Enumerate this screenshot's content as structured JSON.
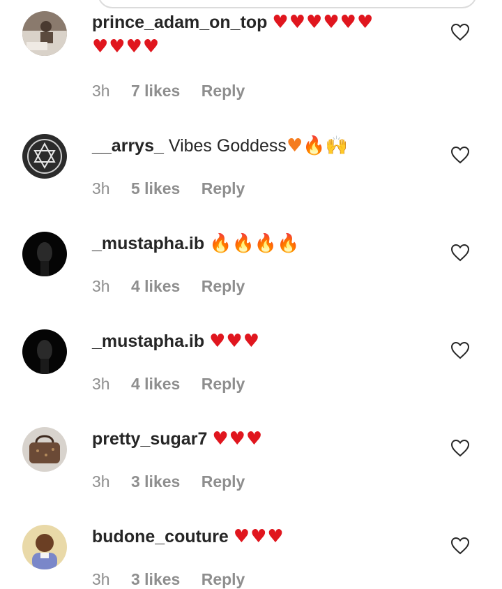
{
  "comments": [
    {
      "username": "prince_adam_on_top",
      "text": "",
      "emoji": "♥♥♥♥♥♥ ♥♥♥♥",
      "emoji_kind": "heart",
      "time": "3h",
      "likes": "7 likes",
      "reply": "Reply",
      "avatar": "avatar-photo-brown"
    },
    {
      "username": "__arrys_",
      "text": "Vibes Goddess",
      "emoji": "♥🔥🙌",
      "emoji_kind": "mixed",
      "time": "3h",
      "likes": "5 likes",
      "reply": "Reply",
      "avatar": "avatar-star-logo"
    },
    {
      "username": "_mustapha.ib",
      "text": "",
      "emoji": "🔥🔥🔥🔥",
      "emoji_kind": "fire",
      "time": "3h",
      "likes": "4 likes",
      "reply": "Reply",
      "avatar": "avatar-dark-portrait"
    },
    {
      "username": "_mustapha.ib",
      "text": "",
      "emoji": "♥♥♥",
      "emoji_kind": "heart",
      "time": "3h",
      "likes": "4 likes",
      "reply": "Reply",
      "avatar": "avatar-dark-portrait"
    },
    {
      "username": "pretty_sugar7",
      "text": "",
      "emoji": "♥♥♥",
      "emoji_kind": "heart",
      "time": "3h",
      "likes": "3 likes",
      "reply": "Reply",
      "avatar": "avatar-handbag"
    },
    {
      "username": "budone_couture",
      "text": "",
      "emoji": "♥♥♥",
      "emoji_kind": "heart",
      "time": "3h",
      "likes": "3 likes",
      "reply": "Reply",
      "avatar": "avatar-person-smiling"
    }
  ],
  "icons": {
    "like": "heart-outline-icon"
  },
  "colors": {
    "text": "#262626",
    "meta": "#8e8e8e",
    "heart_emoji": "#e0161e",
    "fire_emoji": "#f57c1f"
  }
}
